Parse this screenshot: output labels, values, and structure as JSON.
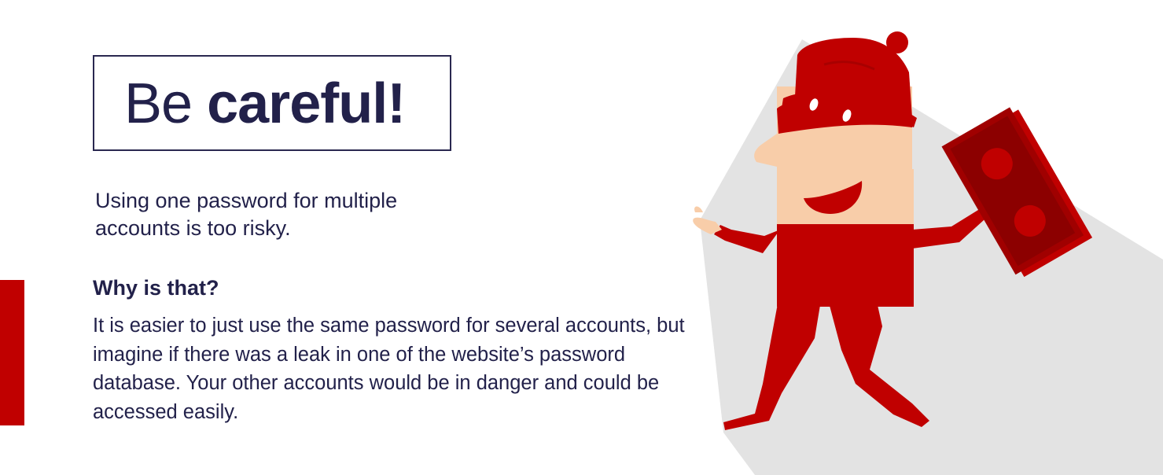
{
  "heading": {
    "regular": "Be",
    "bold": "careful!"
  },
  "intro": "Using one password for multiple accounts is too risky.",
  "question": "Why is that?",
  "explanation": "It is easier to just use the same password for several accounts, but imagine if there was a leak in one of the website’s password database. Your other accounts would be in danger and could be accessed easily.",
  "colors": {
    "accent_red": "#c00000",
    "text_navy": "#22214a",
    "skin": "#f8cda9",
    "shadow": "#e3e3e3"
  },
  "illustration": {
    "character": "masked-thief-icon",
    "prop": "banknote-stack-icon"
  }
}
